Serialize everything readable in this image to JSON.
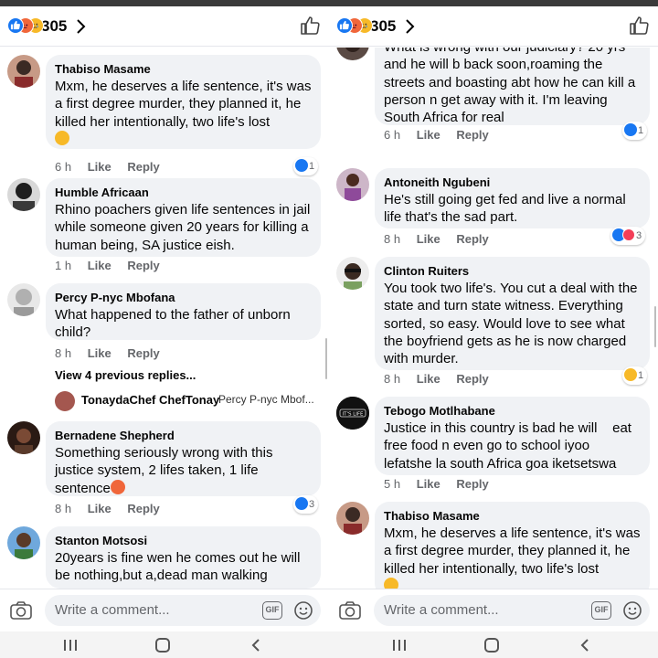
{
  "left": {
    "header": {
      "count": "305"
    },
    "comments": [
      {
        "name": "Thabiso Masame",
        "text": "Mxm, he deserves a life sentence, it's was a first degree murder, they planned it, he killed her intentionally, two life's lost",
        "emoji": "sad",
        "time": "6 h",
        "like": "Like",
        "reply": "Reply",
        "reactions": "1",
        "reaction_types": [
          "like"
        ]
      },
      {
        "name": "Humble Africaan",
        "text": "Rhino poachers given  life sentences in jail while someone given 20 years for killing a human being, SA justice eish.",
        "time": "1 h",
        "like": "Like",
        "reply": "Reply"
      },
      {
        "name": "Percy P-nyc Mbofana",
        "text": "What happened to the father of unborn child?",
        "time": "8 h",
        "like": "Like",
        "reply": "Reply",
        "view_more": "View 4 previous replies...",
        "reply_preview": {
          "name": "TonaydaChef ChefTonay",
          "text": "Percy P-nyc Mbof..."
        }
      },
      {
        "name": "Bernadene Shepherd",
        "text": "Something seriously wrong with this justice system, 2 lifes taken, 1 life sentence",
        "emoji": "angry",
        "time": "8 h",
        "like": "Like",
        "reply": "Reply",
        "reactions": "3",
        "reaction_types": [
          "like"
        ]
      },
      {
        "name": "Stanton Motsosi",
        "text": "20years is fine wen he comes out he will be nothing,but a,dead man walking"
      }
    ],
    "composer": {
      "placeholder": "Write a comment...",
      "gif": "GIF"
    }
  },
  "right": {
    "header": {
      "count": "305"
    },
    "comments": [
      {
        "name": "",
        "text": "What is wrong with our judiciary? 20 yrs and he will b back soon,roaming the streets and boasting abt how he can kill a person n get away with it. I'm leaving South Africa for real",
        "time": "6 h",
        "like": "Like",
        "reply": "Reply",
        "reactions": "1",
        "reaction_types": [
          "like"
        ]
      },
      {
        "name": "Antoneith Ngubeni",
        "text": "He's still going get fed and live a normal life that's the sad part.",
        "time": "8 h",
        "like": "Like",
        "reply": "Reply",
        "reactions": "3",
        "reaction_types": [
          "like",
          "love"
        ]
      },
      {
        "name": "Clinton Ruiters",
        "text": "You took two life's. You cut a deal with the state and turn state witness. Everything sorted, so easy. Would love to see what the boyfriend gets as he is now charged with murder.",
        "time": "8 h",
        "like": "Like",
        "reply": "Reply",
        "reactions": "1",
        "reaction_types": [
          "sad"
        ]
      },
      {
        "name": "Tebogo Motlhabane",
        "text": "Justice in this country is bad he will    eat free food n even go to school iyoo lefatshe la south Africa goa iketsetswa",
        "time": "5 h",
        "like": "Like",
        "reply": "Reply",
        "avatar_text": "IT'S LIFE"
      },
      {
        "name": "Thabiso Masame",
        "text": "Mxm, he deserves a life sentence, it's was a first degree murder, they planned it, he killed her intentionally, two life's lost",
        "emoji": "sad"
      }
    ],
    "composer": {
      "placeholder": "Write a comment...",
      "gif": "GIF"
    }
  },
  "icons": [
    "like-reaction-icon",
    "angry-reaction-icon",
    "sad-reaction-icon",
    "chevron-right-icon",
    "thumbs-up-icon",
    "camera-icon",
    "gif-icon",
    "smiley-icon",
    "menu-icon",
    "home-icon",
    "back-icon"
  ],
  "colors": {
    "brand": "#1877f2",
    "bubble": "#f0f2f5",
    "meta": "#65676b",
    "angry": "#f0663a",
    "sad": "#f7b928",
    "love": "#f33e58"
  }
}
